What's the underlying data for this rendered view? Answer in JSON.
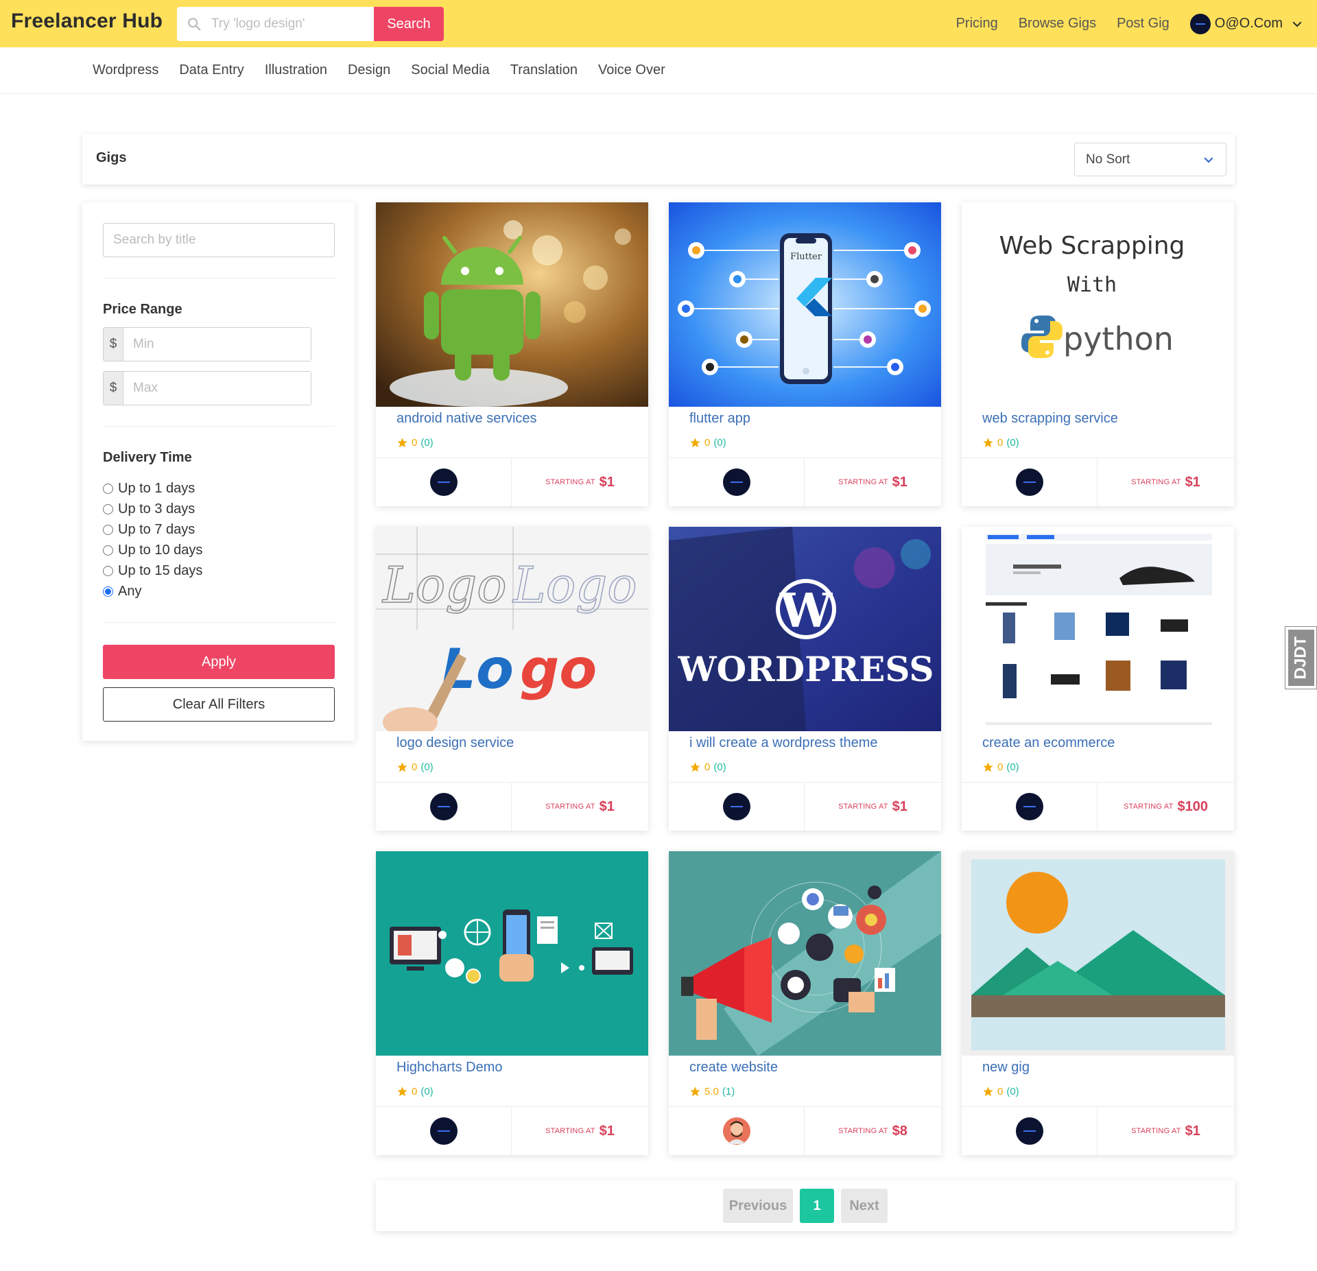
{
  "header": {
    "brand": "Freelancer Hub",
    "search_placeholder": "Try 'logo design'",
    "search_button": "Search",
    "nav": [
      "Pricing",
      "Browse Gigs",
      "Post Gig"
    ],
    "user_email": "O@O.Com"
  },
  "categories": [
    "Wordpress",
    "Data Entry",
    "Illustration",
    "Design",
    "Social Media",
    "Translation",
    "Voice Over"
  ],
  "gigs_header": {
    "title": "Gigs",
    "sort_value": "No Sort"
  },
  "sidebar": {
    "search_placeholder": "Search by title",
    "price_label": "Price Range",
    "currency": "$",
    "min_placeholder": "Min",
    "max_placeholder": "Max",
    "delivery_label": "Delivery Time",
    "delivery_options": [
      "Up to 1 days",
      "Up to 3 days",
      "Up to 7 days",
      "Up to 10 days",
      "Up to 15 days",
      "Any"
    ],
    "delivery_selected": "Any",
    "apply": "Apply",
    "clear": "Clear All Filters"
  },
  "gigs": [
    {
      "title": "android native services",
      "rating": "0",
      "count": "(0)",
      "starting": "STARTING AT",
      "price": "$1",
      "image": "android-photo",
      "seller": "navy-avatar"
    },
    {
      "title": "flutter app",
      "rating": "0",
      "count": "(0)",
      "starting": "STARTING AT",
      "price": "$1",
      "image": "flutter-illustration",
      "seller": "navy-avatar"
    },
    {
      "title": "web scrapping service",
      "rating": "0",
      "count": "(0)",
      "starting": "STARTING AT",
      "price": "$1",
      "image": "python-text",
      "seller": "navy-avatar"
    },
    {
      "title": "logo design service",
      "rating": "0",
      "count": "(0)",
      "starting": "STARTING AT",
      "price": "$1",
      "image": "logo-sketch",
      "seller": "navy-avatar"
    },
    {
      "title": "i will create a wordpress theme",
      "rating": "0",
      "count": "(0)",
      "starting": "STARTING AT",
      "price": "$1",
      "image": "wordpress-banner",
      "seller": "navy-avatar"
    },
    {
      "title": "create an ecommerce",
      "rating": "0",
      "count": "(0)",
      "starting": "STARTING AT",
      "price": "$100",
      "image": "ecommerce-screenshot",
      "seller": "navy-avatar"
    },
    {
      "title": "Highcharts Demo",
      "rating": "0",
      "count": "(0)",
      "starting": "STARTING AT",
      "price": "$1",
      "image": "tech-icons-teal",
      "seller": "navy-avatar"
    },
    {
      "title": "create website",
      "rating": "5.0",
      "count": "(1)",
      "starting": "STARTING AT",
      "price": "$8",
      "image": "megaphone-marketing",
      "seller": "person-avatar"
    },
    {
      "title": "new gig",
      "rating": "0",
      "count": "(0)",
      "starting": "STARTING AT",
      "price": "$1",
      "image": "placeholder-landscape",
      "seller": "navy-avatar"
    }
  ],
  "pagination": {
    "previous": "Previous",
    "current": "1",
    "next": "Next"
  },
  "side_tab": {
    "label": "DJDT"
  },
  "web_scraping_image_text": {
    "line1": "Web Scrapping",
    "line2": "With",
    "brand": "python"
  },
  "colors": {
    "header_bg": "#ffe05a",
    "accent": "#ef4565",
    "title_link": "#3b6fb6",
    "star": "#f2a900",
    "count": "#1fb9a1",
    "price": "#d83f5a",
    "page_active": "#1cc7a0"
  }
}
